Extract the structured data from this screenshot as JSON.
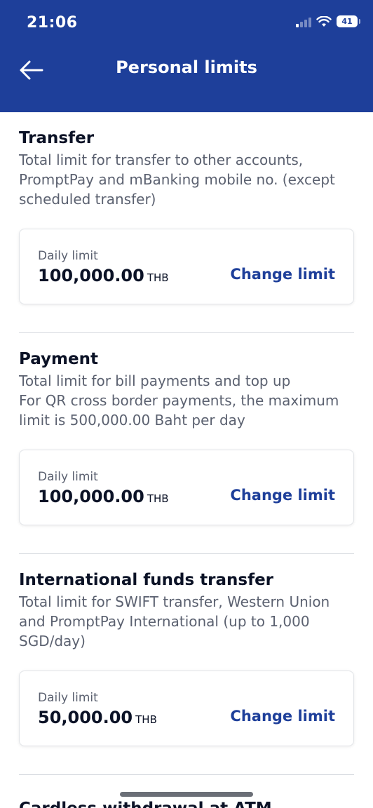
{
  "status_bar": {
    "time": "21:06",
    "battery": "41"
  },
  "header": {
    "title": "Personal limits"
  },
  "sections": [
    {
      "title": "Transfer",
      "description": "Total limit for transfer to other accounts, PromptPay and mBanking mobile no. (except scheduled transfer)",
      "card": {
        "label": "Daily limit",
        "value": "100,000.00",
        "currency": "THB",
        "action": "Change limit"
      }
    },
    {
      "title": "Payment",
      "description_lines": [
        "Total limit for bill payments and top up",
        "For QR cross border payments, the maximum limit is 500,000.00 Baht per day"
      ],
      "card": {
        "label": "Daily limit",
        "value": "100,000.00",
        "currency": "THB",
        "action": "Change limit"
      }
    },
    {
      "title": "International funds transfer",
      "description": "Total limit for SWIFT transfer, Western Union and PromptPay International (up to 1,000 SGD/day)",
      "card": {
        "label": "Daily limit",
        "value": "50,000.00",
        "currency": "THB",
        "action": "Change limit"
      }
    }
  ],
  "next_section_title": "Cardless withdrawal at ATM",
  "colors": {
    "header_bg": "#1e3f9a",
    "accent": "#1e3f9a",
    "text": "#0b1226",
    "muted": "#5b6170"
  }
}
